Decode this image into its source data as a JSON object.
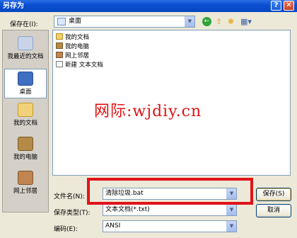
{
  "window": {
    "title": "另存为",
    "help": "?",
    "close": "✕"
  },
  "toolbar": {
    "save_in_label": "保存在(I):",
    "save_in_value": "桌面"
  },
  "places": [
    {
      "label": "我最近的文档",
      "icon": "recent-docs-icon"
    },
    {
      "label": "桌面",
      "icon": "desktop-icon"
    },
    {
      "label": "我的文档",
      "icon": "my-docs-icon"
    },
    {
      "label": "我的电脑",
      "icon": "my-computer-icon"
    },
    {
      "label": "网上邻居",
      "icon": "network-icon"
    }
  ],
  "files": [
    {
      "name": "我的文档",
      "icon": "folder-icon"
    },
    {
      "name": "我的电脑",
      "icon": "computer-icon"
    },
    {
      "name": "网上邻居",
      "icon": "network-icon"
    },
    {
      "name": "新建 文本文档",
      "icon": "text-file-icon"
    }
  ],
  "watermark": "网际:wjdiy.cn",
  "form": {
    "filename_label": "文件名(N):",
    "filename_value": "清除垃圾.bat",
    "filetype_label": "保存类型(T):",
    "filetype_value": "文本文档(*.txt)",
    "encoding_label": "编码(E):",
    "encoding_value": "ANSI"
  },
  "buttons": {
    "save": "保存(S)",
    "cancel": "取消"
  },
  "colors": {
    "highlight": "#e0121a",
    "watermark": "#e31212",
    "titlebar": "#0a4fd1"
  }
}
